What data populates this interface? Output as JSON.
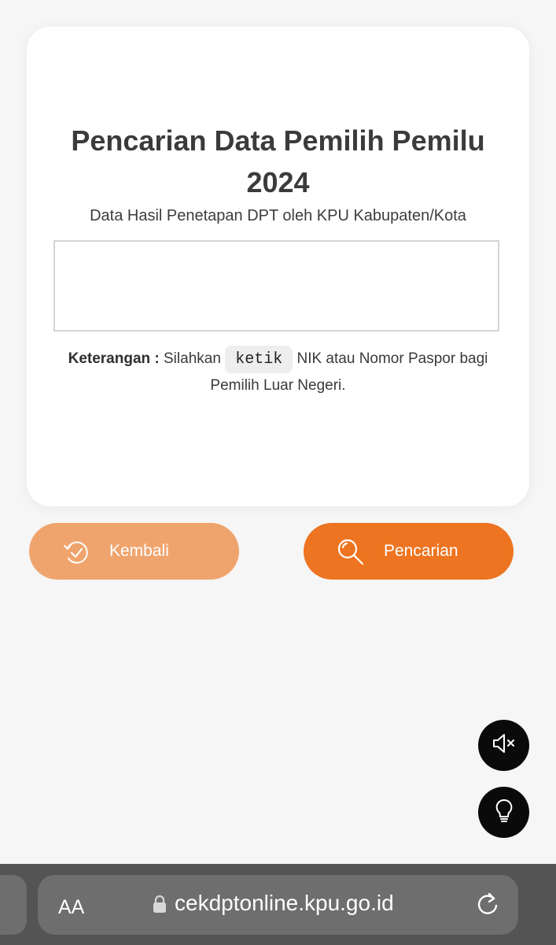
{
  "card": {
    "title": "Pencarian Data Pemilih Pemilu 2024",
    "subtitle": "Data Hasil Penetapan DPT oleh KPU Kabupaten/Kota",
    "search_input": {
      "value": "",
      "placeholder": ""
    },
    "note": {
      "label": "Keterangan :",
      "before": " Silahkan ",
      "code": "ketik",
      "after": " NIK atau Nomor Paspor bagi Pemilih Luar Negeri."
    }
  },
  "buttons": {
    "back": {
      "label": "Kembali",
      "icon": "history-back-icon",
      "color": "#f0a46d"
    },
    "search": {
      "label": "Pencarian",
      "icon": "search-icon",
      "color": "#ed7421"
    }
  },
  "floating": {
    "mute": {
      "icon": "speaker-muted-icon"
    },
    "idea": {
      "icon": "lightbulb-icon"
    }
  },
  "browser": {
    "text_size_label": "AA",
    "url": "cekdptonline.kpu.go.id",
    "lock_icon": "lock-icon",
    "reload_icon": "reload-icon"
  },
  "colors": {
    "accent": "#ed7421",
    "accent_light": "#f0a46d",
    "background": "#f6f6f6"
  }
}
